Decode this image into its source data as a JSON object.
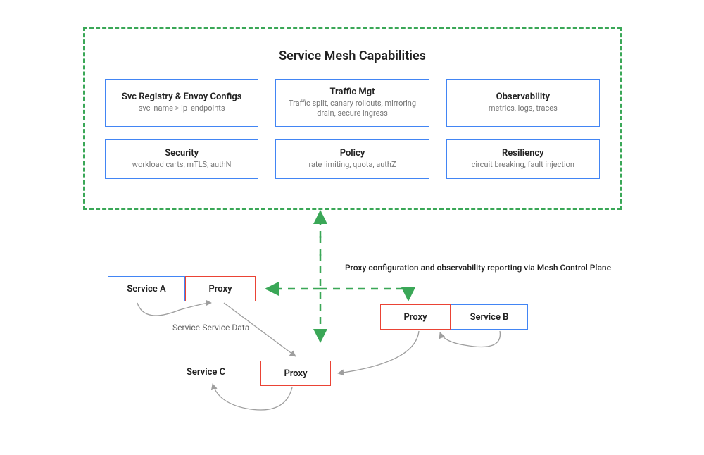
{
  "title": "Service Mesh Capabilities",
  "capabilities": [
    {
      "name": "Svc Registry & Envoy Configs",
      "desc": "svc_name >  ip_endpoints"
    },
    {
      "name": "Traffic Mgt",
      "desc": "Traffic split, canary rollouts, mirroring drain, secure ingress"
    },
    {
      "name": "Observability",
      "desc": "metrics, logs, traces"
    },
    {
      "name": "Security",
      "desc": "workload carts, mTLS, authN"
    },
    {
      "name": "Policy",
      "desc": "rate limiting, quota, authZ"
    },
    {
      "name": "Resiliency",
      "desc": "circuit breaking, fault injection"
    }
  ],
  "nodes": {
    "serviceA": "Service A",
    "serviceB": "Service B",
    "serviceC": "Service C",
    "proxy": "Proxy"
  },
  "labels": {
    "control": "Proxy configuration and observability reporting via Mesh Control Plane",
    "dataPath": "Service-Service Data"
  },
  "colors": {
    "green": "#3aa757",
    "blue": "#4285f4",
    "red": "#ea4335",
    "gray": "#9e9e9e"
  }
}
